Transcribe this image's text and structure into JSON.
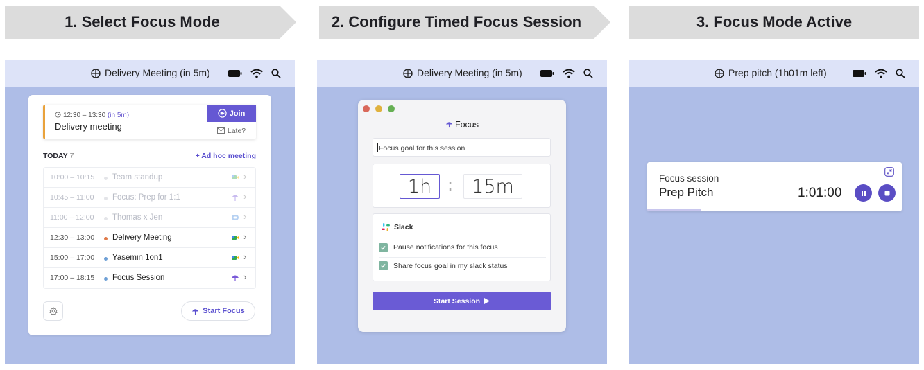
{
  "steps": [
    {
      "label": "1. Select Focus Mode"
    },
    {
      "label": "2. Configure Timed Focus Session"
    },
    {
      "label": "3. Focus Mode Active"
    }
  ],
  "panel1": {
    "menubar_title": "Delivery Meeting (in 5m)",
    "upcoming": {
      "time": "12:30 – 13:30",
      "relative": "(in 5m)",
      "name": "Delivery meeting",
      "join_label": "Join",
      "late_label": "Late?"
    },
    "today_label": "TODAY",
    "today_count": "7",
    "adhoc_label": "+ Ad hoc meeting",
    "events": [
      {
        "time": "10:00 – 10:15",
        "name": "Team standup",
        "dot": "#b9bcc6",
        "icon": "video-icon",
        "past": true
      },
      {
        "time": "10:45 – 11:00",
        "name": "Focus: Prep for 1:1",
        "dot": "#b9bcc6",
        "icon": "umbrella-icon",
        "past": true
      },
      {
        "time": "11:00 – 12:00",
        "name": "Thomas x Jen",
        "dot": "#b9bcc6",
        "icon": "chat-icon",
        "past": true
      },
      {
        "time": "12:30 – 13:00",
        "name": "Delivery Meeting",
        "dot": "#e07b4a",
        "icon": "video-icon",
        "past": false
      },
      {
        "time": "15:00 – 17:00",
        "name": "Yasemin 1on1",
        "dot": "#6ea0d6",
        "icon": "video-icon",
        "past": false
      },
      {
        "time": "17:00 – 18:15",
        "name": "Focus Session",
        "dot": "#6ea0d6",
        "icon": "umbrella-icon",
        "past": false
      }
    ],
    "start_focus_label": "Start Focus"
  },
  "panel2": {
    "menubar_title": "Delivery Meeting (in 5m)",
    "title": "Focus",
    "goal_placeholder": "Focus goal for this session",
    "hours": "1h",
    "minutes": "15m",
    "separator": ":",
    "slack_label": "Slack",
    "options": [
      {
        "label": "Pause notifications for this focus",
        "checked": true
      },
      {
        "label": "Share focus goal in my slack status",
        "checked": true
      }
    ],
    "start_session_label": "Start Session"
  },
  "panel3": {
    "menubar_title": "Prep pitch (1h01m left)",
    "session_label": "Focus session",
    "session_name": "Prep Pitch",
    "remaining": "1:01:00",
    "progress": 0.21
  },
  "colors": {
    "accent": "#6558d3",
    "panel_bg": "#aebde7",
    "menubar_bg": "#dde3f8",
    "banner_bg": "#dcdcdc",
    "upcoming_bar": "#e9a23b"
  }
}
